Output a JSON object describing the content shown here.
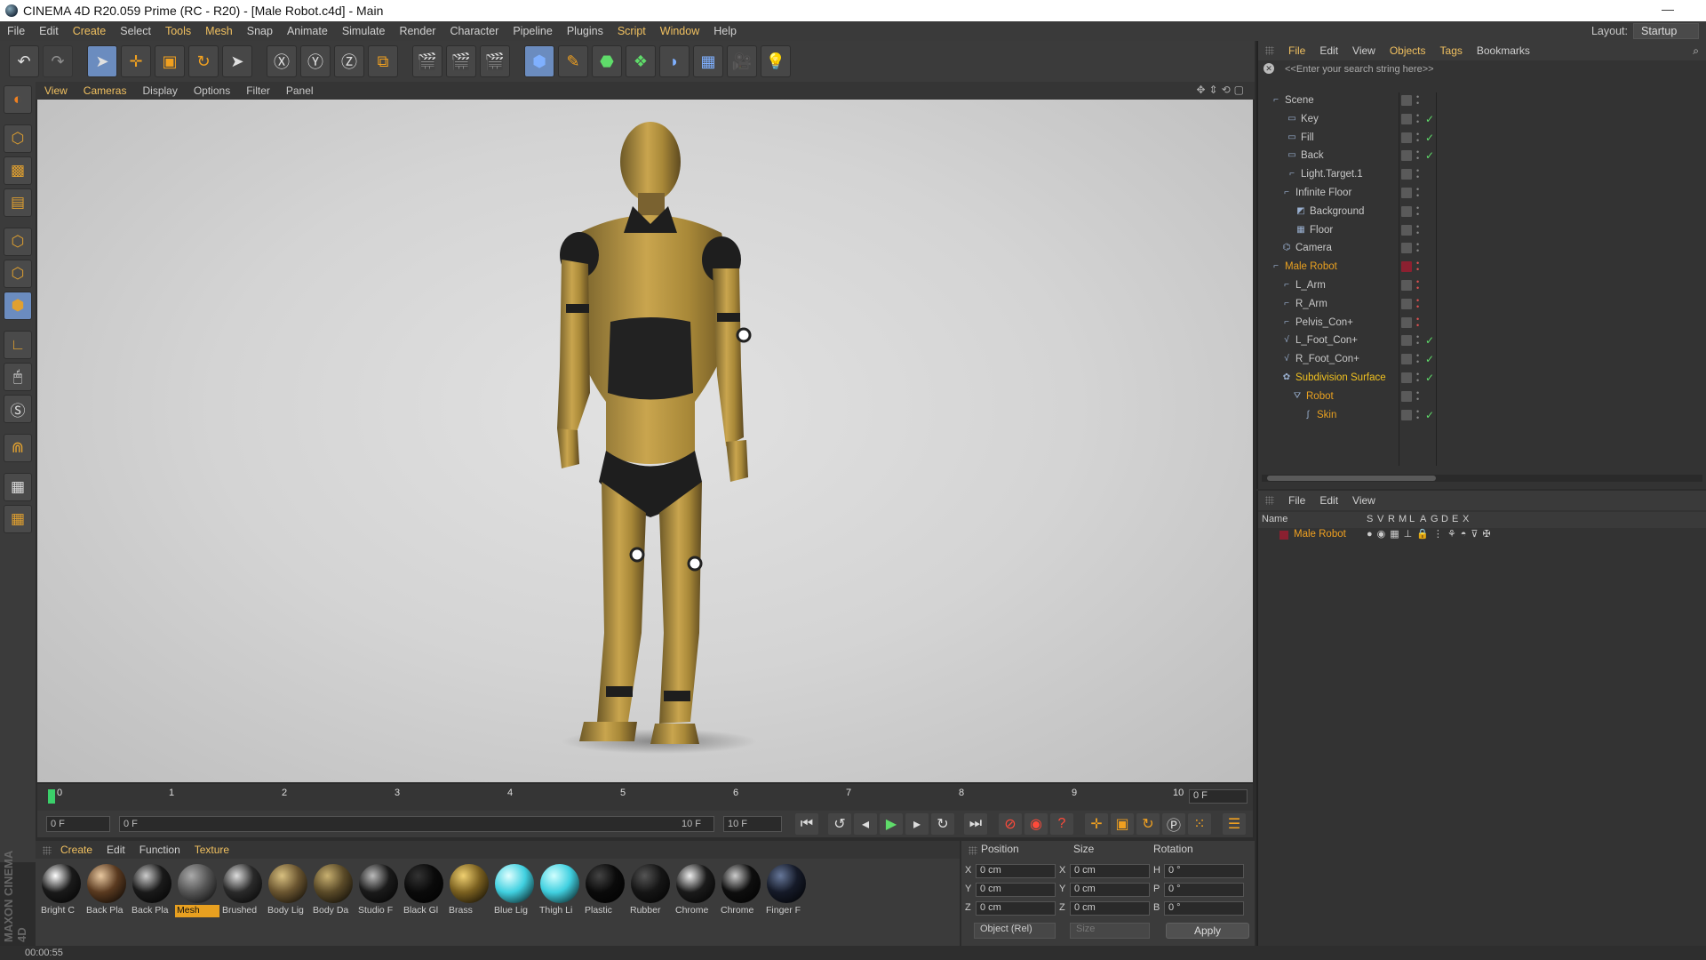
{
  "title": "CINEMA 4D R20.059 Prime (RC - R20) - [Male Robot.c4d] - Main",
  "window_minimize": "—",
  "menu": [
    "File",
    "Edit",
    "Create",
    "Select",
    "Tools",
    "Mesh",
    "Snap",
    "Animate",
    "Simulate",
    "Render",
    "Character",
    "Pipeline",
    "Plugins",
    "Script",
    "Window",
    "Help"
  ],
  "layout": {
    "label": "Layout:",
    "value": "Startup"
  },
  "viewport_menu": [
    "View",
    "Cameras",
    "Display",
    "Options",
    "Filter",
    "Panel"
  ],
  "object_manager": {
    "menu": [
      "File",
      "Edit",
      "View",
      "Objects",
      "Tags",
      "Bookmarks"
    ],
    "search_placeholder": "<<Enter your search string here>>",
    "objects": [
      {
        "name": "Scene",
        "color": "#c8c8c8"
      },
      {
        "name": "Key",
        "color": "#c8c8c8"
      },
      {
        "name": "Fill",
        "color": "#c8c8c8"
      },
      {
        "name": "Back",
        "color": "#c8c8c8"
      },
      {
        "name": "Light.Target.1",
        "color": "#c8c8c8"
      },
      {
        "name": "Infinite Floor",
        "color": "#c8c8c8"
      },
      {
        "name": "Background",
        "color": "#c8c8c8"
      },
      {
        "name": "Floor",
        "color": "#c8c8c8"
      },
      {
        "name": "Camera",
        "color": "#c8c8c8"
      },
      {
        "name": "Male Robot",
        "color": "#e8a020"
      },
      {
        "name": "L_Arm",
        "color": "#c8c8c8"
      },
      {
        "name": "R_Arm",
        "color": "#c8c8c8"
      },
      {
        "name": "Pelvis_Con+",
        "color": "#c8c8c8"
      },
      {
        "name": "L_Foot_Con+",
        "color": "#c8c8c8"
      },
      {
        "name": "R_Foot_Con+",
        "color": "#c8c8c8"
      },
      {
        "name": "Subdivision Surface",
        "color": "#f0c020"
      },
      {
        "name": "Robot",
        "color": "#e8a020"
      },
      {
        "name": "Skin",
        "color": "#e8a020"
      }
    ]
  },
  "layer_manager": {
    "menu": [
      "File",
      "Edit",
      "View"
    ],
    "columns": [
      "Name",
      "S",
      "V",
      "R",
      "M",
      "L",
      "A",
      "G",
      "D",
      "E",
      "X"
    ],
    "layers": [
      {
        "name": "Male Robot",
        "color": "#8b2030"
      }
    ]
  },
  "timeline": {
    "ticks": [
      "0",
      "1",
      "2",
      "3",
      "4",
      "5",
      "6",
      "7",
      "8",
      "9",
      "10"
    ],
    "current_frame": "0 F"
  },
  "transport": {
    "start_frame": "0 F",
    "range_start": "0 F",
    "range_end": "10 F",
    "end_frame": "10 F"
  },
  "material_manager": {
    "menu": [
      "Create",
      "Edit",
      "Function",
      "Texture"
    ],
    "materials": [
      {
        "label": "Bright C",
        "color": "#1a1a1a",
        "highlight": "#ffffff"
      },
      {
        "label": "Back Pla",
        "color": "#5a3a20",
        "highlight": "#e8c8a0"
      },
      {
        "label": "Back Pla",
        "color": "#1a1a1a",
        "highlight": "#cccccc"
      },
      {
        "label": "Mesh",
        "color": "#555555",
        "highlight": "#aaaaaa"
      },
      {
        "label": "Brushed",
        "color": "#2a2a2a",
        "highlight": "#dddddd"
      },
      {
        "label": "Body Lig",
        "color": "#6a5530",
        "highlight": "#d8c080"
      },
      {
        "label": "Body Da",
        "color": "#5a4a28",
        "highlight": "#c8b070"
      },
      {
        "label": "Studio F",
        "color": "#1a1a1a",
        "highlight": "#bbbbbb"
      },
      {
        "label": "Black Gl",
        "color": "#0a0a0a",
        "highlight": "#333333"
      },
      {
        "label": "Brass",
        "color": "#7a6020",
        "highlight": "#f0d070"
      },
      {
        "label": "Blue Lig",
        "color": "#40d0e0",
        "highlight": "#e0ffff"
      },
      {
        "label": "Thigh Li",
        "color": "#40d0e0",
        "highlight": "#d0ffff"
      },
      {
        "label": "Plastic",
        "color": "#0a0a0a",
        "highlight": "#444444"
      },
      {
        "label": "Rubber",
        "color": "#151515",
        "highlight": "#555555"
      },
      {
        "label": "Chrome",
        "color": "#1a1a1a",
        "highlight": "#eeeeee"
      },
      {
        "label": "Chrome",
        "color": "#0e0e0e",
        "highlight": "#cccccc"
      },
      {
        "label": "Finger F",
        "color": "#151a28",
        "highlight": "#667799"
      }
    ]
  },
  "coordinates": {
    "headers": [
      "Position",
      "Size",
      "Rotation"
    ],
    "axes": [
      "X",
      "Y",
      "Z"
    ],
    "rot_axes": [
      "H",
      "P",
      "B"
    ],
    "position": [
      "0 cm",
      "0 cm",
      "0 cm"
    ],
    "size": [
      "0 cm",
      "0 cm",
      "0 cm"
    ],
    "rotation": [
      "0 °",
      "0 °",
      "0 °"
    ],
    "mode": "Object (Rel)",
    "size_mode": "Size",
    "apply": "Apply"
  },
  "status": "00:00:55",
  "logo": "MAXON CINEMA 4D",
  "colors": {
    "accent": "#f0c060",
    "selected": "#e8a020",
    "robot_gold": "#b8963c"
  }
}
